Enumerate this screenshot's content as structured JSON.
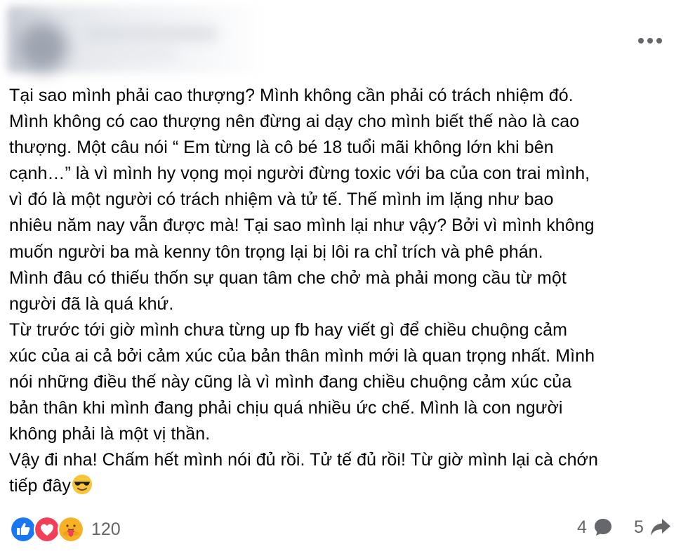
{
  "post": {
    "more_icon": "ellipsis-horizontal-icon",
    "paragraphs": [
      "Tại sao mình phải cao thượng? Mình không cần phải có trách nhiệm đó.",
      "Mình không có cao thượng nên đừng ai dạy cho mình biết thế nào là cao",
      "thượng. Một câu nói “ Em từng là cô bé 18 tuổi mãi không lớn khi bên",
      "cạnh…” là vì mình hy vọng mọi người đừng toxic với ba của con trai mình,",
      "vì đó là một người có trách nhiệm và tử tế. Thế mình im lặng như bao",
      "nhiêu năm nay vẫn được mà! Tại sao mình lại như vậy? Bởi vì mình không",
      "muốn người ba mà kenny tôn trọng lại bị lôi ra chỉ trích và phê phán.",
      "Mình đâu có thiếu thốn sự quan tâm che chở mà phải mong cầu từ một",
      "người đã là quá khứ.",
      "Từ trước tới giờ mình chưa từng up fb hay viết gì để chiều chuộng cảm",
      "xúc của ai cả bởi cảm xúc của bản thân mình mới là quan trọng nhất. Mình",
      "nói những điều thế này cũng là vì mình đang chiều chuộng cảm xúc của",
      "bản thân khi mình đang phải chịu quá nhiều ức chế. Mình là con người",
      "không phải là một vị thần.",
      "Vậy đi nha! Chấm hết mình nói đủ rồi. Tử tế đủ rồi! Từ giờ mình lại cà chớn",
      "tiếp đây"
    ],
    "trailing_emoji": "smiling-face-with-sunglasses"
  },
  "footer": {
    "reactions": {
      "icons": [
        "like-icon",
        "love-icon",
        "care-icon"
      ],
      "count": "120",
      "colors": {
        "like": "#1877f2",
        "love": "#f33e58",
        "care": "#f7b125"
      }
    },
    "comments": {
      "count": "4",
      "icon": "comment-bubble-icon"
    },
    "shares": {
      "count": "5",
      "icon": "share-arrow-icon"
    }
  }
}
